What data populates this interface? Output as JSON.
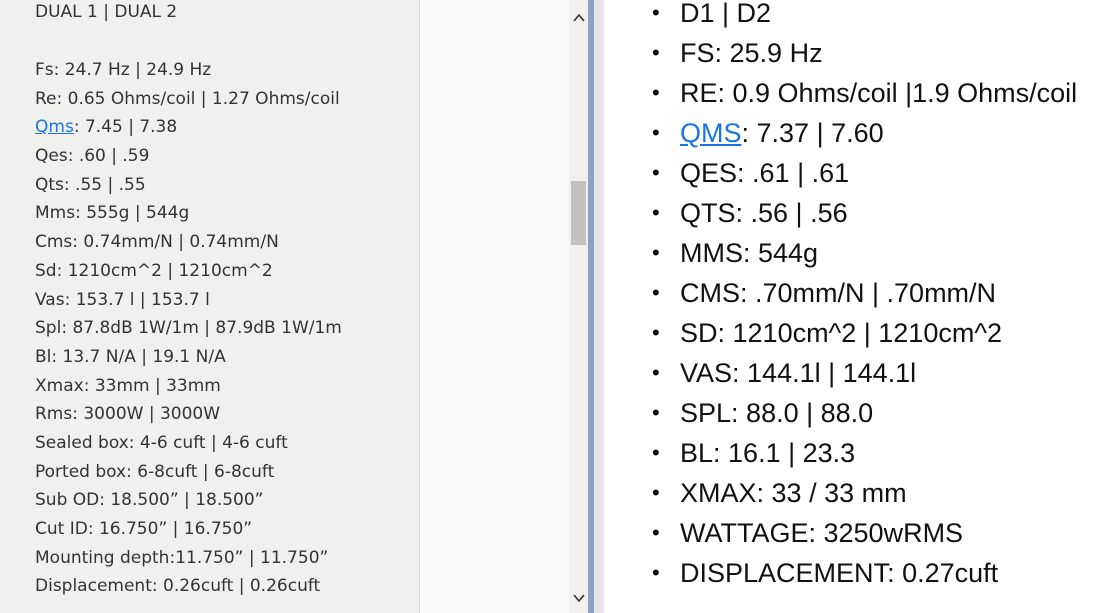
{
  "left": {
    "header": "DUAL 1 | DUAL 2",
    "items": [
      {
        "key": "Fs",
        "text": ": 24.7 Hz | 24.9 Hz",
        "link": false
      },
      {
        "key": "Re",
        "text": ": 0.65 Ohms/coil | 1.27 Ohms/coil",
        "link": false
      },
      {
        "key": "Qms",
        "text": ": 7.45 | 7.38",
        "link": true
      },
      {
        "key": "Qes",
        "text": ": .60 | .59",
        "link": false
      },
      {
        "key": "Qts",
        "text": ": .55 | .55",
        "link": false
      },
      {
        "key": "Mms",
        "text": ": 555g | 544g",
        "link": false
      },
      {
        "key": "Cms",
        "text": ": 0.74mm/N | 0.74mm/N",
        "link": false
      },
      {
        "key": "Sd",
        "text": ": 1210cm^2 | 1210cm^2",
        "link": false
      },
      {
        "key": "Vas",
        "text": ": 153.7 l | 153.7 l",
        "link": false
      },
      {
        "key": "Spl",
        "text": ": 87.8dB 1W/1m | 87.9dB 1W/1m",
        "link": false
      },
      {
        "key": "Bl",
        "text": ": 13.7 N/A | 19.1 N/A",
        "link": false
      },
      {
        "key": "Xmax",
        "text": ": 33mm | 33mm",
        "link": false
      },
      {
        "key": "Rms",
        "text": ": 3000W | 3000W",
        "link": false
      },
      {
        "key": "Sealed box",
        "text": ": 4-6 cuft | 4-6 cuft",
        "link": false
      },
      {
        "key": "Ported box",
        "text": ": 6-8cuft | 6-8cuft",
        "link": false
      },
      {
        "key": "Sub OD",
        "text": ": 18.500” | 18.500”",
        "link": false
      },
      {
        "key": "Cut ID",
        "text": ": 16.750” | 16.750”",
        "link": false
      },
      {
        "key": "Mounting depth",
        "text": ":11.750” | 11.750”",
        "link": false
      },
      {
        "key": "Displacement",
        "text": ": 0.26cuft | 0.26cuft",
        "link": false
      }
    ]
  },
  "right": {
    "items": [
      {
        "key": "D1 | D2",
        "text": "",
        "link": false
      },
      {
        "key": "FS",
        "text": ": 25.9 Hz",
        "link": false
      },
      {
        "key": "RE",
        "text": ": 0.9 Ohms/coil |1.9 Ohms/coil",
        "link": false
      },
      {
        "key": "QMS",
        "text": ": 7.37 | 7.60",
        "link": true
      },
      {
        "key": "QES",
        "text": ": .61 | .61",
        "link": false
      },
      {
        "key": "QTS",
        "text": ": .56 | .56",
        "link": false
      },
      {
        "key": "MMS",
        "text": ": 544g",
        "link": false
      },
      {
        "key": "CMS",
        "text": ": .70mm/N | .70mm/N",
        "link": false
      },
      {
        "key": "SD",
        "text": ": 1210cm^2 | 1210cm^2",
        "link": false
      },
      {
        "key": "VAS",
        "text": ": 144.1l | 144.1l",
        "link": false
      },
      {
        "key": "SPL",
        "text": ": 88.0 | 88.0",
        "link": false
      },
      {
        "key": "BL",
        "text": ": 16.1 | 23.3",
        "link": false
      },
      {
        "key": "XMAX",
        "text": ": 33 / 33 mm",
        "link": false
      },
      {
        "key": "WATTAGE",
        "text": ": 3250wRMS",
        "link": false
      },
      {
        "key": "DISPLACEMENT",
        "text": ": 0.27cuft",
        "link": false
      }
    ],
    "bullet": "•"
  },
  "scrollbar": {
    "up_icon": "chevron-up-icon",
    "down_icon": "chevron-down-icon"
  },
  "colors": {
    "link": "#1a73e8",
    "left_bg": "#f0f0ee",
    "divider": "#8aa4c8"
  }
}
